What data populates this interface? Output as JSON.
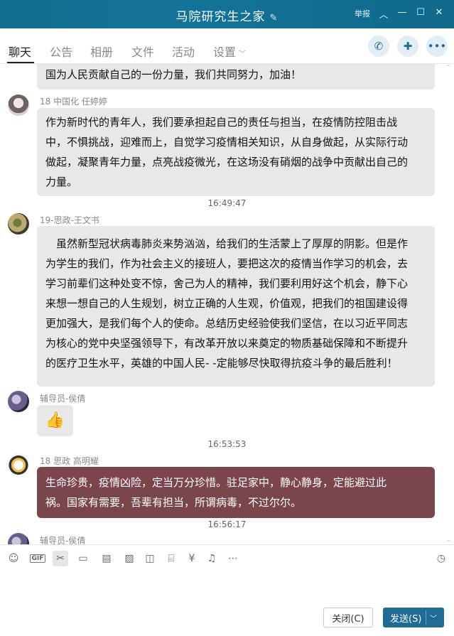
{
  "window": {
    "title": "马院研究生之家",
    "report_label": "举报",
    "icons": [
      "edit-icon",
      "collapse-up-icon",
      "minimize-icon",
      "maximize-icon",
      "close-icon"
    ]
  },
  "tabs": [
    {
      "label": "聊天"
    },
    {
      "label": "公告"
    },
    {
      "label": "相册"
    },
    {
      "label": "文件"
    },
    {
      "label": "活动"
    },
    {
      "label": "设置"
    }
  ],
  "header_actions": [
    "phone-icon",
    "chat-plus-icon",
    "more-icon"
  ],
  "messages": [
    {
      "text_lines": [
        "国为人民贡献自己的一份力量，我们共同努力，加油！"
      ]
    },
    {
      "sender": "18 中国化 任婷婷",
      "text_lines": [
        "作为新时代的青年人，我们要承担起自己的责任与担当，在疫情防控阻击战",
        "中，不惧挑战，迎难而上，自觉学习疫情相关知识，从自身做起，从实际行动",
        "做起，凝聚青年力量，点亮战疫微光，在这场没有硝烟的战争中贡献出自己的",
        "力量。"
      ]
    },
    {
      "time": "16:49:47"
    },
    {
      "sender": "19-思政-王文书",
      "text_lines": [
        "　虽然新型冠状病毒肺炎来势汹汹，给我们的生活蒙上了厚厚的阴影。但是作",
        "为学生的我们，作为社会主义的接班人，要把这次的疫情当作学习的机会，去",
        "学习前辈们这种处变不惊，舍己为人的精神，我们要利用好这个机会，静下心",
        "来想一想自己的人生规划，树立正确的人生观，价值观，把我们的祖国建设得",
        "更加强大，是我们每个人的使命。总结历史经验使我们坚信，在以习近平同志",
        "为核心的党中央坚强领导下，有改革开放以来奠定的物质基础保障和不断提升",
        "的医疗卫生水平，英雄的中国人民- -定能够尽快取得抗疫斗争的最后胜利！"
      ]
    },
    {
      "sender": "辅导员-侯倩",
      "emoji": "👍"
    },
    {
      "time": "16:53:53"
    },
    {
      "sender": "18 思政 高明耀",
      "text_lines": [
        "生命珍贵，疫情凶险，定当万分珍惜。驻足家中，静心静身，定能避过此",
        "祸。国家有需要，吾辈有担当，所谓病毒，不过尔尔。"
      ]
    },
    {
      "time": "16:56:17"
    },
    {
      "sender": "辅导员-侯倩"
    }
  ],
  "toolbar": [
    "emoji-icon",
    "gif-icon",
    "scissors-icon",
    "folder-icon",
    "document-icon",
    "image-icon",
    "gift-box-icon",
    "gift-icon",
    "red-packet-icon",
    "bell-icon",
    "more-circle-icon",
    "history-clock-icon"
  ],
  "gif_label": "GIF",
  "buttons": {
    "close": "关闭(C)",
    "send": "发送(S)"
  },
  "colors": {
    "titlebar": "#13739a",
    "highlight_bubble": "#7a464c",
    "send_button": "#1e6c95"
  }
}
